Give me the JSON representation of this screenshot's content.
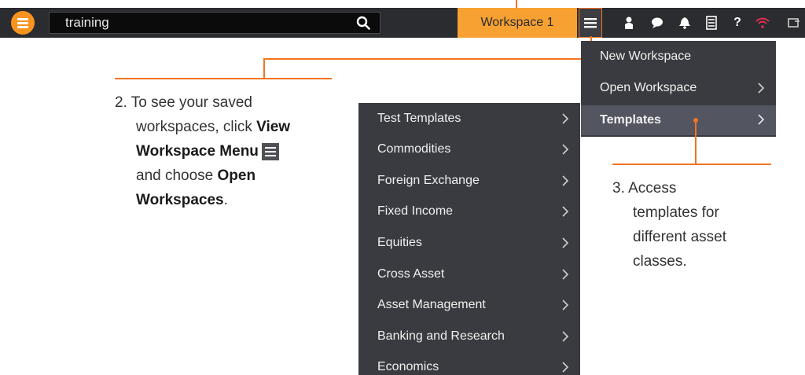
{
  "toolbar": {
    "search_value": "training",
    "workspace_tab": "Workspace 1",
    "icons": [
      "person-icon",
      "chat-icon",
      "bell-icon",
      "list-icon",
      "help-icon",
      "wifi-icon",
      "window-icon"
    ],
    "help_glyph": "?",
    "accent_color": "#f7931e"
  },
  "workspace_menu": {
    "items": [
      {
        "label": "New Workspace",
        "submenu": false
      },
      {
        "label": "Open Workspace",
        "submenu": true
      },
      {
        "label": "Templates",
        "submenu": true
      }
    ]
  },
  "templates_menu": {
    "items": [
      {
        "label": "Test Templates"
      },
      {
        "label": "Commodities"
      },
      {
        "label": "Foreign Exchange"
      },
      {
        "label": "Fixed Income"
      },
      {
        "label": "Equities"
      },
      {
        "label": "Cross Asset"
      },
      {
        "label": "Asset Management"
      },
      {
        "label": "Banking and Research"
      },
      {
        "label": "Economics"
      }
    ]
  },
  "callouts": {
    "step2": {
      "prefix": "2. To see your saved",
      "line2": "workspaces, click",
      "bold1a": "View",
      "bold1b": "Workspace Menu",
      "line4": "and choose",
      "bold2a": "Open",
      "bold2b": "Workspaces",
      "suffix": "."
    },
    "step3": {
      "line1": "3. Access",
      "line2": "templates for",
      "line3": "different asset",
      "line4": "classes."
    }
  }
}
